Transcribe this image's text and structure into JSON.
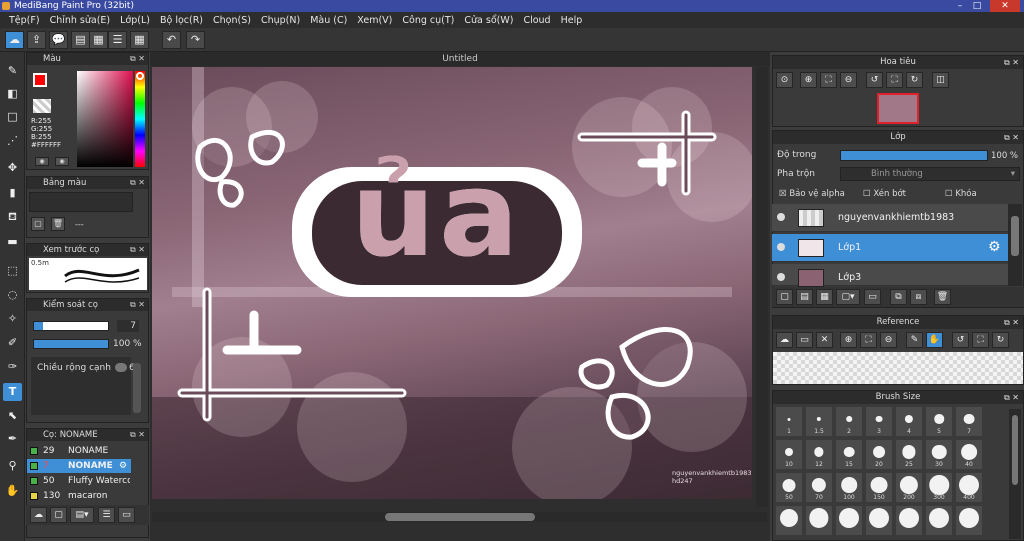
{
  "window": {
    "title": "MediBang Paint Pro (32bit)"
  },
  "menu": [
    "Tệp(F)",
    "Chỉnh sửa(E)",
    "Lớp(L)",
    "Bộ lọc(R)",
    "Chọn(S)",
    "Chụp(N)",
    "Màu (C)",
    "Xem(V)",
    "Công cụ(T)",
    "Cửa sổ(W)",
    "Cloud",
    "Help"
  ],
  "document": {
    "tab_title": "Untitled"
  },
  "color_panel": {
    "title": "Màu",
    "rgb": [
      "R:255",
      "G:255",
      "B:255"
    ],
    "hex": "#FFFFFF",
    "colors": {
      "primary": "#ff0000",
      "secondary": "#ffffff"
    }
  },
  "palette_panel": {
    "title": "Bảng màu",
    "dash": "---"
  },
  "preview_panel": {
    "title": "Xem trước cọ",
    "size_label": "0.5m"
  },
  "brush_control": {
    "title": "Kiểm soát cọ",
    "size_value": "7",
    "size_fill": 0.12,
    "opacity_value": "100 %",
    "opacity_fill": 1.0,
    "width_label": "Chiều rộng cạnh",
    "width_value": "6"
  },
  "brush_list": {
    "title": "Cọ: NONAME",
    "items": [
      {
        "size": "29",
        "name": "NONAME",
        "color": "#4ab04a"
      },
      {
        "size": "7",
        "name": "NONAME",
        "color": "#4ab04a"
      },
      {
        "size": "50",
        "name": "Fluffy Watercolor",
        "color": "#4ab04a"
      },
      {
        "size": "130",
        "name": "macaron",
        "color": "#e6d24a"
      }
    ]
  },
  "artwork": {
    "main_text": "ủa",
    "watermark_line1": "nguyenvankhiemtb1983",
    "watermark_line2": "hd247"
  },
  "navigator": {
    "title": "Hoa tiêu"
  },
  "layer_panel": {
    "title": "Lớp",
    "opacity_label": "Độ trong",
    "opacity_value": "100 %",
    "opacity_fill": 1.0,
    "blend_label": "Pha trộn",
    "blend_value": "Bình thường",
    "protect_alpha": "Bảo vệ alpha",
    "clipping": "Xén bớt",
    "lock": "Khóa",
    "layers": [
      {
        "name": "nguyenvankhiemtb1983",
        "selected": false
      },
      {
        "name": "Lớp1",
        "selected": true
      },
      {
        "name": "Lớp3",
        "selected": false
      }
    ]
  },
  "reference_panel": {
    "title": "Reference"
  },
  "brush_size_panel": {
    "title": "Brush Size",
    "sizes": [
      "1",
      "1.5",
      "2",
      "3",
      "4",
      "5",
      "7",
      "10",
      "12",
      "15",
      "20",
      "25",
      "30",
      "40",
      "50",
      "70",
      "100",
      "150",
      "200",
      "300",
      "400",
      "",
      "",
      "",
      "",
      "",
      "",
      ""
    ]
  }
}
